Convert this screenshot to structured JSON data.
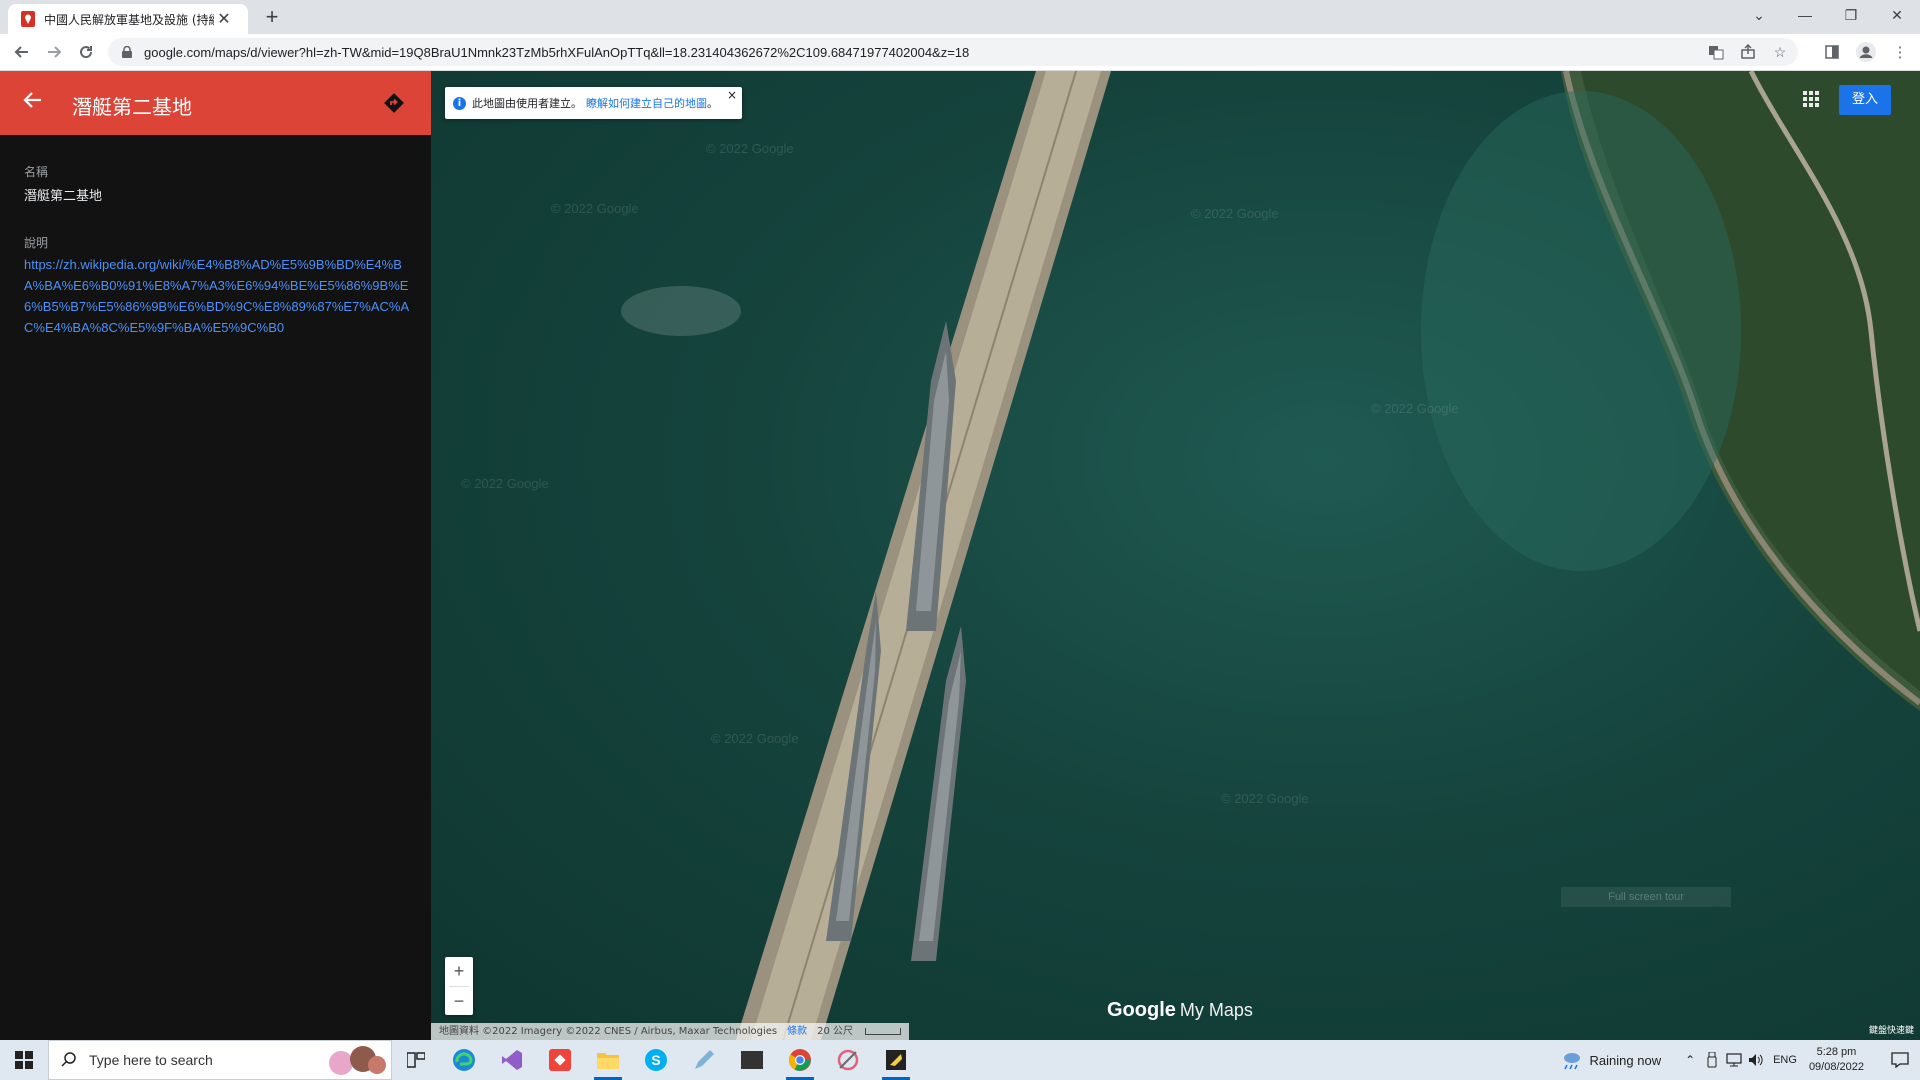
{
  "browser": {
    "tab_title": "中國人民解放軍基地及設施 (持續",
    "tab_close": "✕",
    "new_tab": "+",
    "url": "google.com/maps/d/viewer?hl=zh-TW&mid=19Q8BraU1Nmnk23TzMb5rhXFulAnOpTTq&ll=18.231404362672%2C109.68471977402004&z=18",
    "window_controls": [
      "⌄",
      "—",
      "❐",
      "✕"
    ]
  },
  "panel": {
    "title": "潛艇第二基地",
    "name_label": "名稱",
    "name_value": "潛艇第二基地",
    "desc_label": "說明",
    "desc_link": "https://zh.wikipedia.org/wiki/%E4%B8%AD%E5%9B%BD%E4%BA%BA%E6%B0%91%E8%A7%A3%E6%94%BE%E5%86%9B%E6%B5%B7%E5%86%9B%E6%BD%9C%E8%89%87%E7%AC%AC%E4%BA%8C%E5%9F%BA%E5%9C%B0"
  },
  "map": {
    "info_text": "此地圖由使用者建立。",
    "info_link": "瞭解如何建立自己的地圖",
    "info_dot": "。",
    "info_close": "×",
    "signin_label": "登入",
    "zoom_in": "+",
    "zoom_out": "−",
    "brand_google": "Google",
    "brand_mymaps": "My Maps",
    "attribution": "地圖資料 ©2022 Imagery ©2022 CNES / Airbus, Maxar Technologies",
    "terms": "條款",
    "scale": "20 公尺",
    "corner_label": "鍵盤快速鍵",
    "watermark": "© 2022 Google",
    "fullscreen_tip": "Full screen tour"
  },
  "taskbar": {
    "search_placeholder": "Type here to search",
    "weather": "Raining now",
    "lang": "ENG",
    "time": "5:28 pm",
    "date": "09/08/2022"
  },
  "colors": {
    "header_red": "#db4437",
    "panel_bg": "#121212",
    "link_blue": "#4f8ff7",
    "signin_blue": "#1a73e8",
    "water": "#15443d"
  }
}
